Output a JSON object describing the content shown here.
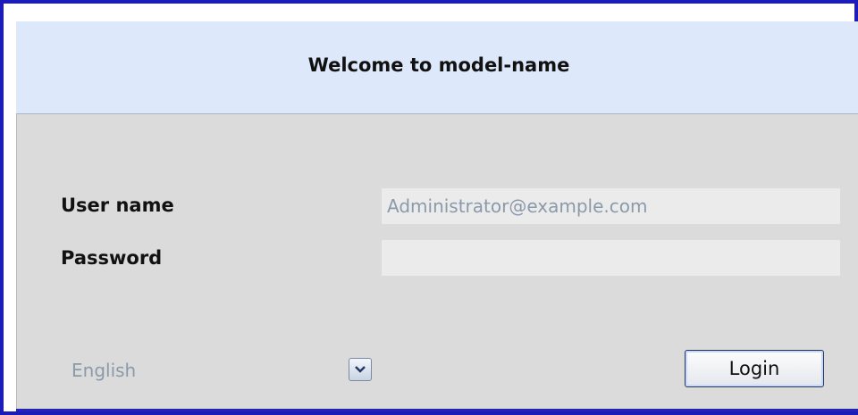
{
  "header": {
    "title": "Welcome to model-name"
  },
  "form": {
    "username_label": "User name",
    "username_value": "Administrator@example.com",
    "password_label": "Password",
    "password_value": ""
  },
  "language": {
    "selected": "English",
    "icon": "chevron-down-icon"
  },
  "buttons": {
    "login_label": "Login"
  },
  "colors": {
    "frame_border": "#1c1cb8",
    "header_bg": "#dde9fb",
    "panel_bg": "#dbdbdb",
    "field_bg": "#ebebeb",
    "muted_text": "#8b9aab"
  }
}
